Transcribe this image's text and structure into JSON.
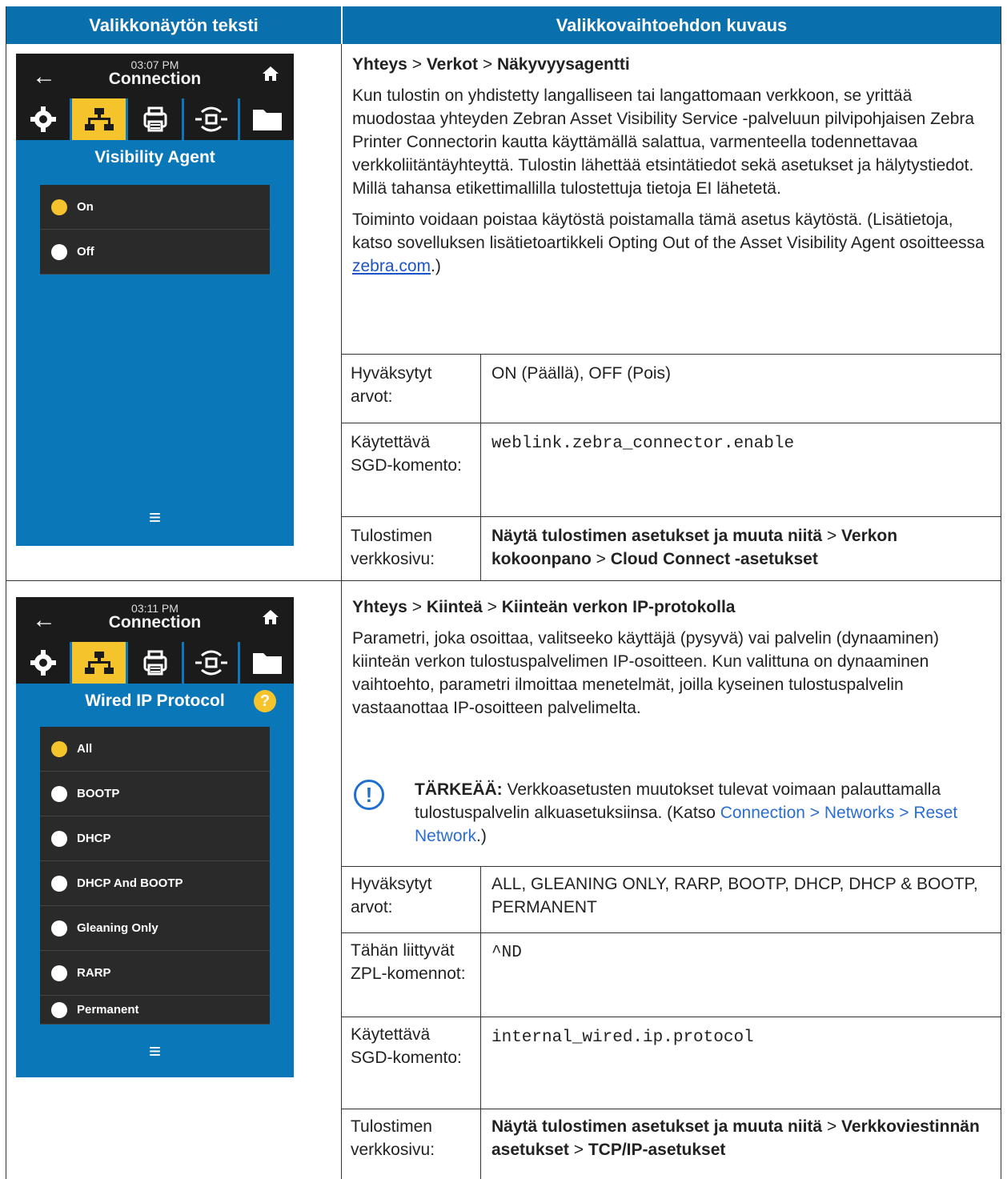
{
  "header": {
    "col1": "Valikkonäytön teksti",
    "col2": "Valikkovaihtoehdon kuvaus"
  },
  "screen1": {
    "time": "03:07 PM",
    "title": "Connection",
    "screen_title": "Visibility Agent",
    "options": [
      {
        "label": "On",
        "selected": true
      },
      {
        "label": "Off",
        "selected": false
      }
    ],
    "icons": [
      "back-arrow-icon",
      "home-icon",
      "gear-icon",
      "network-icon",
      "printer-icon",
      "wireless-icon",
      "folder-icon",
      "menu-icon"
    ]
  },
  "section1": {
    "path": [
      {
        "text": "Yhteys"
      },
      {
        "text": "Verkot"
      },
      {
        "text": "Näkyvyysagentti"
      }
    ],
    "para1": "Kun tulostin on yhdistetty langalliseen tai langattomaan verkkoon, se yrittää muodostaa yhteyden Zebran Asset Visibility Service -palveluun pilvipohjaisen Zebra Printer Connectorin kautta käyttämällä salattua, varmenteella todennettavaa verkkoliitäntäyhteyttä. Tulostin lähettää etsintätiedot sekä asetukset ja hälytystiedot. Millä tahansa etikettimallilla tulostettuja tietoja EI lähetetä.",
    "para2_prefix": "Toiminto voidaan poistaa käytöstä poistamalla tämä asetus käytöstä. (Lisätietoja, katso sovelluksen lisätietoartikkeli Opting Out of the Asset Visibility Agent osoitteessa ",
    "para2_link": "zebra.com",
    "para2_suffix": ".)",
    "rows": {
      "accepted_label": "Hyväksytyt arvot:",
      "accepted_value": "ON (Päällä), OFF (Pois)",
      "sgd_label": "Käytettävä SGD-komento:",
      "sgd_value": "weblink.zebra_connector.enable",
      "web_label": "Tulostimen verkkosivu:",
      "web_a": "Näytä tulostimen asetukset ja muuta niitä",
      "web_b": "Verkon kokoonpano",
      "web_c": "Cloud Connect -asetukset"
    }
  },
  "screen2": {
    "time": "03:11 PM",
    "title": "Connection",
    "screen_title": "Wired IP Protocol",
    "help": "?",
    "options": [
      {
        "label": "All",
        "selected": true
      },
      {
        "label": "BOOTP",
        "selected": false
      },
      {
        "label": "DHCP",
        "selected": false
      },
      {
        "label": "DHCP And BOOTP",
        "selected": false
      },
      {
        "label": "Gleaning Only",
        "selected": false
      },
      {
        "label": "RARP",
        "selected": false
      },
      {
        "label": "Permanent",
        "selected": false
      }
    ]
  },
  "section2": {
    "path": [
      {
        "text": "Yhteys"
      },
      {
        "text": "Kiinteä"
      },
      {
        "text": "Kiinteän verkon IP-protokolla"
      }
    ],
    "para1": "Parametri, joka osoittaa, valitseeko käyttäjä (pysyvä) vai palvelin (dynaaminen) kiinteän verkon tulostuspalvelimen IP-osoitteen. Kun valittuna on dynaaminen vaihtoehto, parametri ilmoittaa menetelmät, joilla kyseinen tulostuspalvelin vastaanottaa IP-osoitteen palvelimelta.",
    "note_label": "TÄRKEÄÄ:",
    "note_text": "Verkkoasetusten muutokset tulevat voimaan palauttamalla tulostuspalvelin alkuasetuksiinsa. (Katso ",
    "note_link": "Connection > Networks > Reset Network",
    "note_suffix": ".)",
    "rows": {
      "accepted_label": "Hyväksytyt arvot:",
      "accepted_value": "ALL, GLEANING ONLY, RARP, BOOTP, DHCP, DHCP & BOOTP, PERMANENT",
      "zpl_label": "Tähän liittyvät ZPL-komennot:",
      "zpl_value": "^ND",
      "sgd_label": "Käytettävä SGD-komento:",
      "sgd_value": "internal_wired.ip.protocol",
      "web_label": "Tulostimen verkkosivu:",
      "web_a": "Näytä tulostimen asetukset ja muuta niitä",
      "web_b": "Verkkoviestinnän asetukset",
      "web_c": "TCP/IP-asetukset"
    }
  }
}
